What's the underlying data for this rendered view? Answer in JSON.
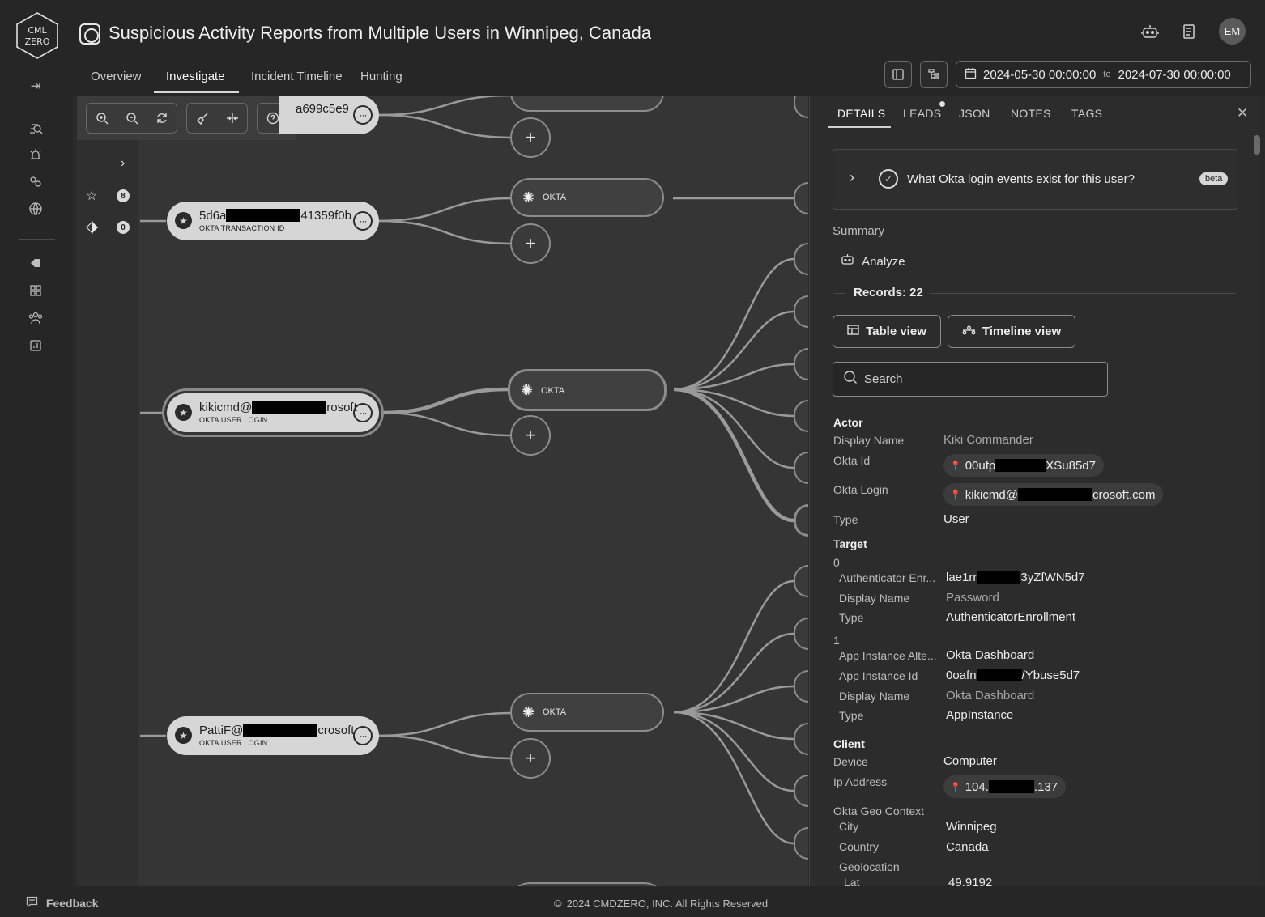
{
  "brand": {
    "logo_top": "CML",
    "logo_bottom": "ZERO"
  },
  "header": {
    "title": "Suspicious Activity Reports from Multiple Users in Winnipeg, Canada",
    "avatar_initials": "EM",
    "tabs": [
      {
        "label": "Overview"
      },
      {
        "label": "Investigate"
      },
      {
        "label": "Incident Timeline"
      },
      {
        "label": "Hunting"
      }
    ],
    "date_range": {
      "from": "2024-05-30 00:00:00",
      "to_label": "to",
      "to": "2024-07-30 00:00:00"
    }
  },
  "filters": {
    "favorites_count": "8",
    "tags_count": "0"
  },
  "graph": {
    "nodes": [
      {
        "label_pre": "",
        "label_post": "a699c5e9",
        "sub": ""
      },
      {
        "label_pre": "5d6a",
        "label_post": "41359f0b",
        "sub": "OKTA TRANSACTION ID"
      },
      {
        "label_pre": "kikicmd@",
        "label_post": "rosoft",
        "sub": "OKTA USER LOGIN"
      },
      {
        "label_pre": "PattiF@",
        "label_post": "crosoft",
        "sub": "OKTA USER LOGIN"
      }
    ],
    "sources": [
      {
        "label": "OKTA"
      },
      {
        "label": "OKTA"
      },
      {
        "label": "OKTA"
      }
    ],
    "plus": "+"
  },
  "panel": {
    "tabs": [
      {
        "label": "DETAILS"
      },
      {
        "label": "LEADS"
      },
      {
        "label": "JSON"
      },
      {
        "label": "NOTES"
      },
      {
        "label": "TAGS"
      }
    ],
    "question": "What Okta login events exist for this user?",
    "beta": "beta",
    "summary_label": "Summary",
    "analyze_label": "Analyze",
    "records_label": "Records: 22",
    "table_view": "Table view",
    "timeline_view": "Timeline view",
    "search_placeholder": "Search",
    "actor": {
      "heading": "Actor",
      "display_name_key": "Display Name",
      "display_name": "Kiki Commander",
      "okta_id_key": "Okta Id",
      "okta_id_pre": "00ufp",
      "okta_id_post": "XSu85d7",
      "okta_login_key": "Okta Login",
      "okta_login_pre": "kikicmd@",
      "okta_login_post": "crosoft.com",
      "type_key": "Type",
      "type": "User"
    },
    "target": {
      "heading": "Target",
      "items": [
        {
          "index": "0",
          "k1": "Authenticator Enr...",
          "v1_pre": "lae1rr",
          "v1_post": "3yZfWN5d7",
          "k2": "Display Name",
          "v2": "Password",
          "k3": "Type",
          "v3": "AuthenticatorEnrollment"
        },
        {
          "index": "1",
          "k0": "App Instance Alte...",
          "v0": "Okta Dashboard",
          "k1": "App Instance Id",
          "v1_pre": "0oafn",
          "v1_post": "/Ybuse5d7",
          "k2": "Display Name",
          "v2": "Okta Dashboard",
          "k3": "Type",
          "v3": "AppInstance"
        }
      ]
    },
    "client": {
      "heading": "Client",
      "device_key": "Device",
      "device": "Computer",
      "ip_key": "Ip Address",
      "ip_pre": "104.",
      "ip_post": ".137",
      "geo_key": "Okta Geo Context",
      "city_key": "City",
      "city": "Winnipeg",
      "country_key": "Country",
      "country": "Canada",
      "geolocation_key": "Geolocation",
      "lat_key": "Lat",
      "lat": "49.9192"
    }
  },
  "footer": {
    "feedback": "Feedback",
    "copyright": "2024 CMDZERO, INC.   All Rights Reserved"
  }
}
